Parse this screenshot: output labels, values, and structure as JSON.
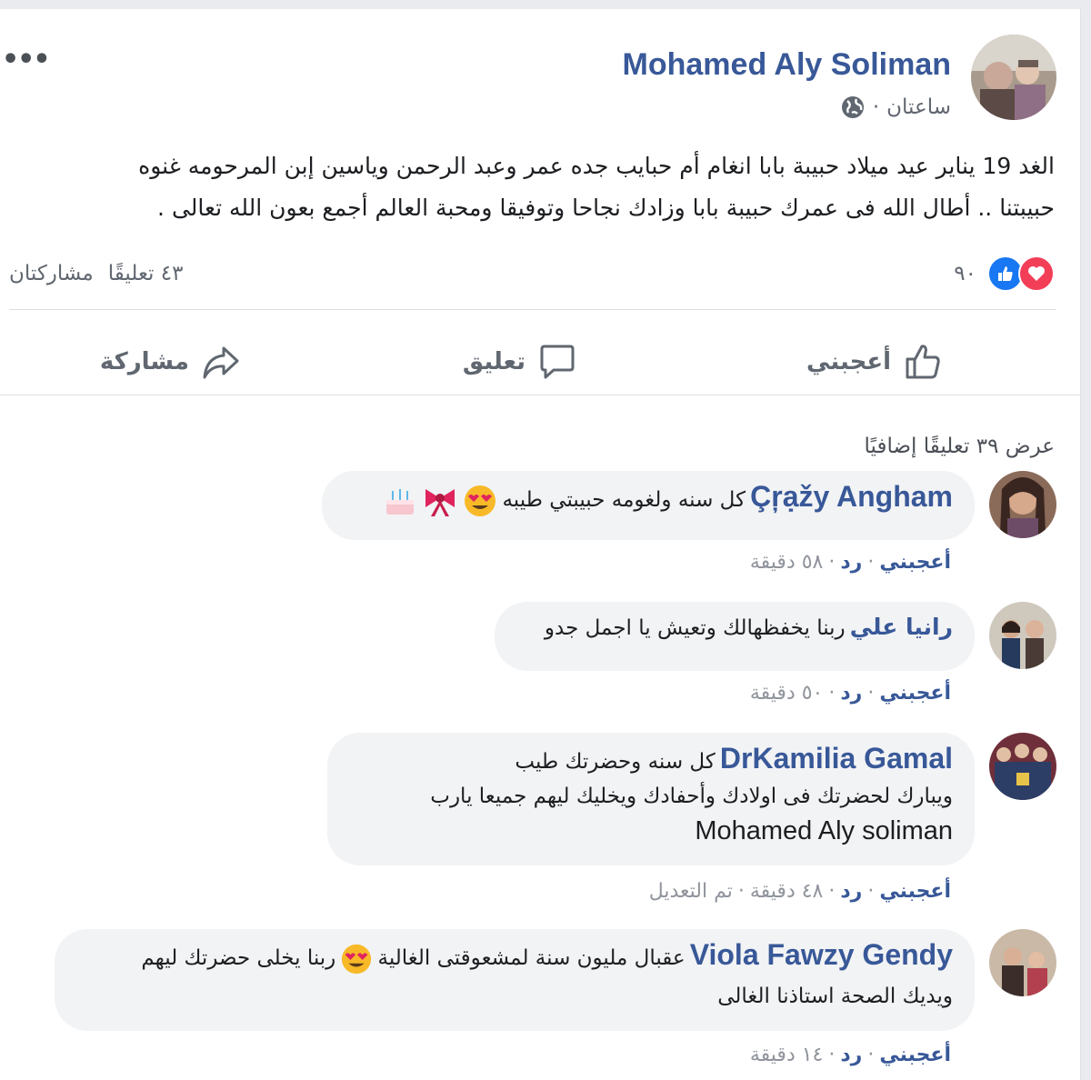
{
  "post": {
    "author": "Mohamed Aly Soliman",
    "time": "ساعتان",
    "meta_sep": "·",
    "more_icon": "•••",
    "text_line1": "الغد 19 يناير عيد ميلاد حبيبة بابا انغام أم حبايب جده عمر وعبد الرحمن وياسين إبن المرحومه غنوه",
    "text_line2": "حبيبتنا .. أطال الله فى عمرك حبيبة بابا وزادك نجاحا وتوفيقا ومحبة العالم أجمع بعون الله تعالى .",
    "reaction_count": "٩٠",
    "comments_count": "٤٣ تعليقًا",
    "shares_count": "مشاركتان"
  },
  "actions": {
    "like": "أعجبني",
    "comment": "تعليق",
    "share": "مشاركة"
  },
  "more_comments": "عرض ٣٩ تعليقًا إضافيًا",
  "comments": [
    {
      "author": "Çŗạžy Angham",
      "text": "كل سنه ولغومه حبيبتي طيبه",
      "like": "أعجبني",
      "reply": "رد",
      "time": "٥٨ دقيقة"
    },
    {
      "author": "رانيا علي",
      "text": "ربنا يخفظهالك وتعيش يا اجمل جدو",
      "like": "أعجبني",
      "reply": "رد",
      "time": "٥٠ دقيقة"
    },
    {
      "author": "DrKamilia Gamal",
      "text": "كل سنه وحضرتك طيب",
      "line2": "ويبارك لحضرتك فى اولادك وأحفادك ويخليك ليهم جميعا يارب",
      "line3": "Mohamed Aly soliman",
      "like": "أعجبني",
      "reply": "رد",
      "time": "٤٨ دقيقة",
      "edited": "تم التعديل"
    },
    {
      "author": "Viola Fawzy Gendy",
      "text": "عقبال مليون سنة لمشعوقتى الغالية",
      "text_b": "ربنا يخلى حضرتك ليهم",
      "line2": "ويديك الصحة استاذنا الغالى",
      "like": "أعجبني",
      "reply": "رد",
      "time": "١٤ دقيقة"
    }
  ],
  "colors": {
    "link": "#385898",
    "like_blue": "#1877f2",
    "love_red": "#f33e58",
    "bubble": "#f2f3f5",
    "muted": "#90949c"
  },
  "icons": [
    "globe-icon",
    "like-reaction-icon",
    "love-reaction-icon",
    "thumbs-up-icon",
    "comment-icon",
    "share-icon",
    "heart-eyes-emoji",
    "ribbon-emoji",
    "cake-emoji"
  ]
}
